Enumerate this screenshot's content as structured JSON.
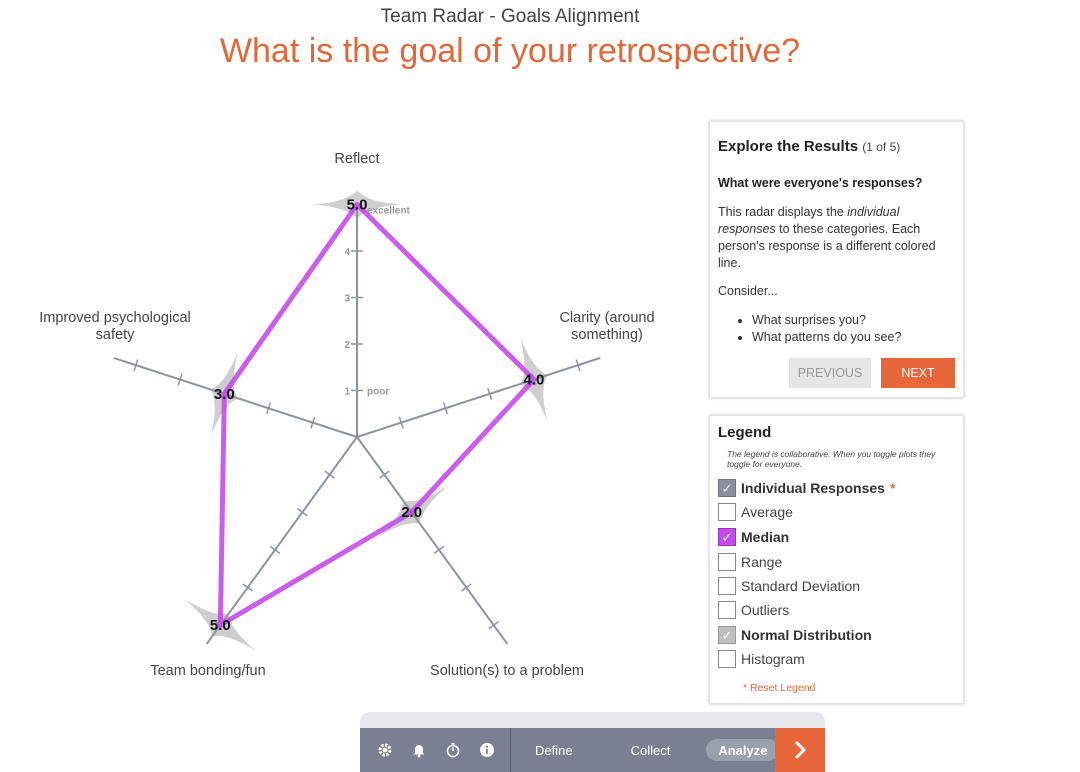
{
  "header": {
    "subtitle": "Team Radar - Goals Alignment",
    "title": "What is the goal of your retrospective?"
  },
  "chart_data": {
    "type": "radar",
    "axes": [
      "Reflect",
      "Clarity (around something)",
      "Solution(s) to a problem",
      "Team bonding/fun",
      "Improved psychological safety"
    ],
    "scale_min": 0,
    "scale_max": 5,
    "tick_labels": [
      "1",
      "2",
      "3",
      "4"
    ],
    "scale_low_label": "poor",
    "scale_high_label": "excellent",
    "series": [
      {
        "values": [
          5.0,
          4.0,
          2.0,
          5.0,
          3.0
        ],
        "color": "#c54bea"
      }
    ],
    "value_labels": [
      "5.0",
      "4.0",
      "2.0",
      "5.0",
      "3.0"
    ],
    "distribution_color": "#c9c9c9",
    "axis_color": "#8e93a3"
  },
  "explore": {
    "heading": "Explore the Results",
    "count": "(1 of 5)",
    "question": "What were everyone's responses?",
    "body_pre": "This radar displays the ",
    "body_em": "individual responses",
    "body_post": " to these categories. Each person's response is a different colored line.",
    "consider": "Consider...",
    "bullets": [
      "What surprises you?",
      "What patterns do you see?"
    ],
    "prev_label": "PREVIOUS",
    "next_label": "NEXT"
  },
  "legend": {
    "title": "Legend",
    "note": "The legend is collaborative. When you toggle plots they toggle for everyone.",
    "items": [
      {
        "label": "Individual Responses",
        "checked": true,
        "style": "gray",
        "bold": true,
        "star": "*"
      },
      {
        "label": "Average",
        "checked": false
      },
      {
        "label": "Median",
        "checked": true,
        "style": "magenta",
        "bold": true
      },
      {
        "label": "Range",
        "checked": false
      },
      {
        "label": "Standard Deviation",
        "checked": false
      },
      {
        "label": "Outliers",
        "checked": false
      },
      {
        "label": "Normal Distribution",
        "checked": true,
        "style": "lightgray",
        "bold": true
      },
      {
        "label": "Histogram",
        "checked": false
      }
    ],
    "reset": "* Reset Legend"
  },
  "toolbar": {
    "icons": [
      "gear-icon",
      "bell-icon",
      "stopwatch-icon",
      "info-icon"
    ],
    "tabs": [
      "Define",
      "Collect",
      "Analyze"
    ],
    "active_tab": "Analyze",
    "next_icon": "chevron-right-icon"
  }
}
